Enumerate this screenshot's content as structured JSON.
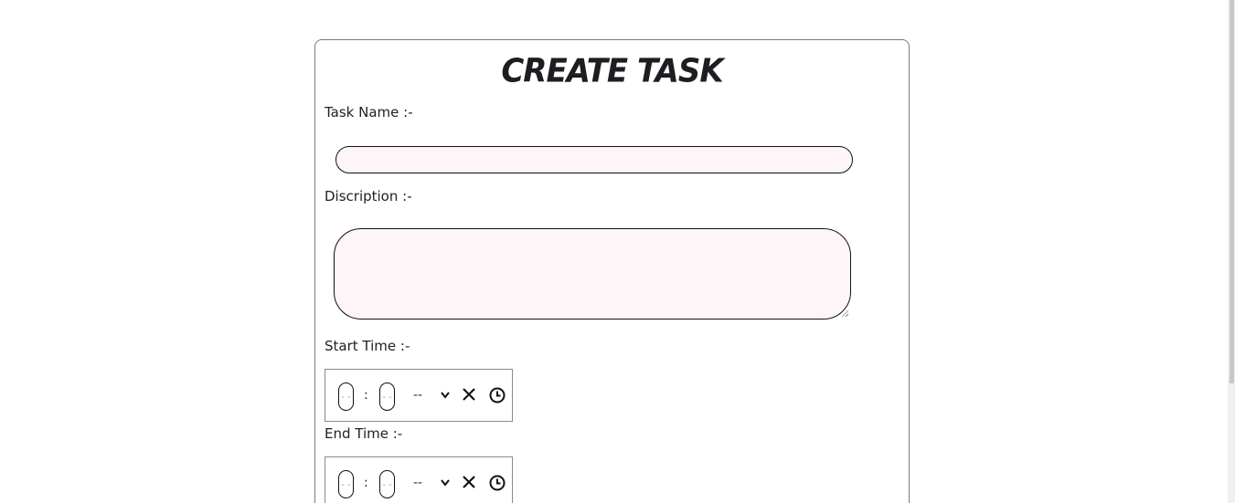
{
  "form": {
    "title": "Create Task",
    "task_name_label": "Task Name :-",
    "task_name_value": "",
    "description_label": "Discription :-",
    "description_value": "",
    "start_time_label": "Start Time :-",
    "end_time_label": "End Time :-",
    "time_placeholder": {
      "hour": "--",
      "minute": "--",
      "separator": ":",
      "ampm": "--"
    }
  },
  "icons": {
    "dropdown": "chevron-down-icon",
    "clear": "close-icon",
    "clock": "clock-icon"
  },
  "colors": {
    "input_background": "#fdf5f7",
    "card_border": "#7a7a7a",
    "title": "#1e1e22"
  }
}
